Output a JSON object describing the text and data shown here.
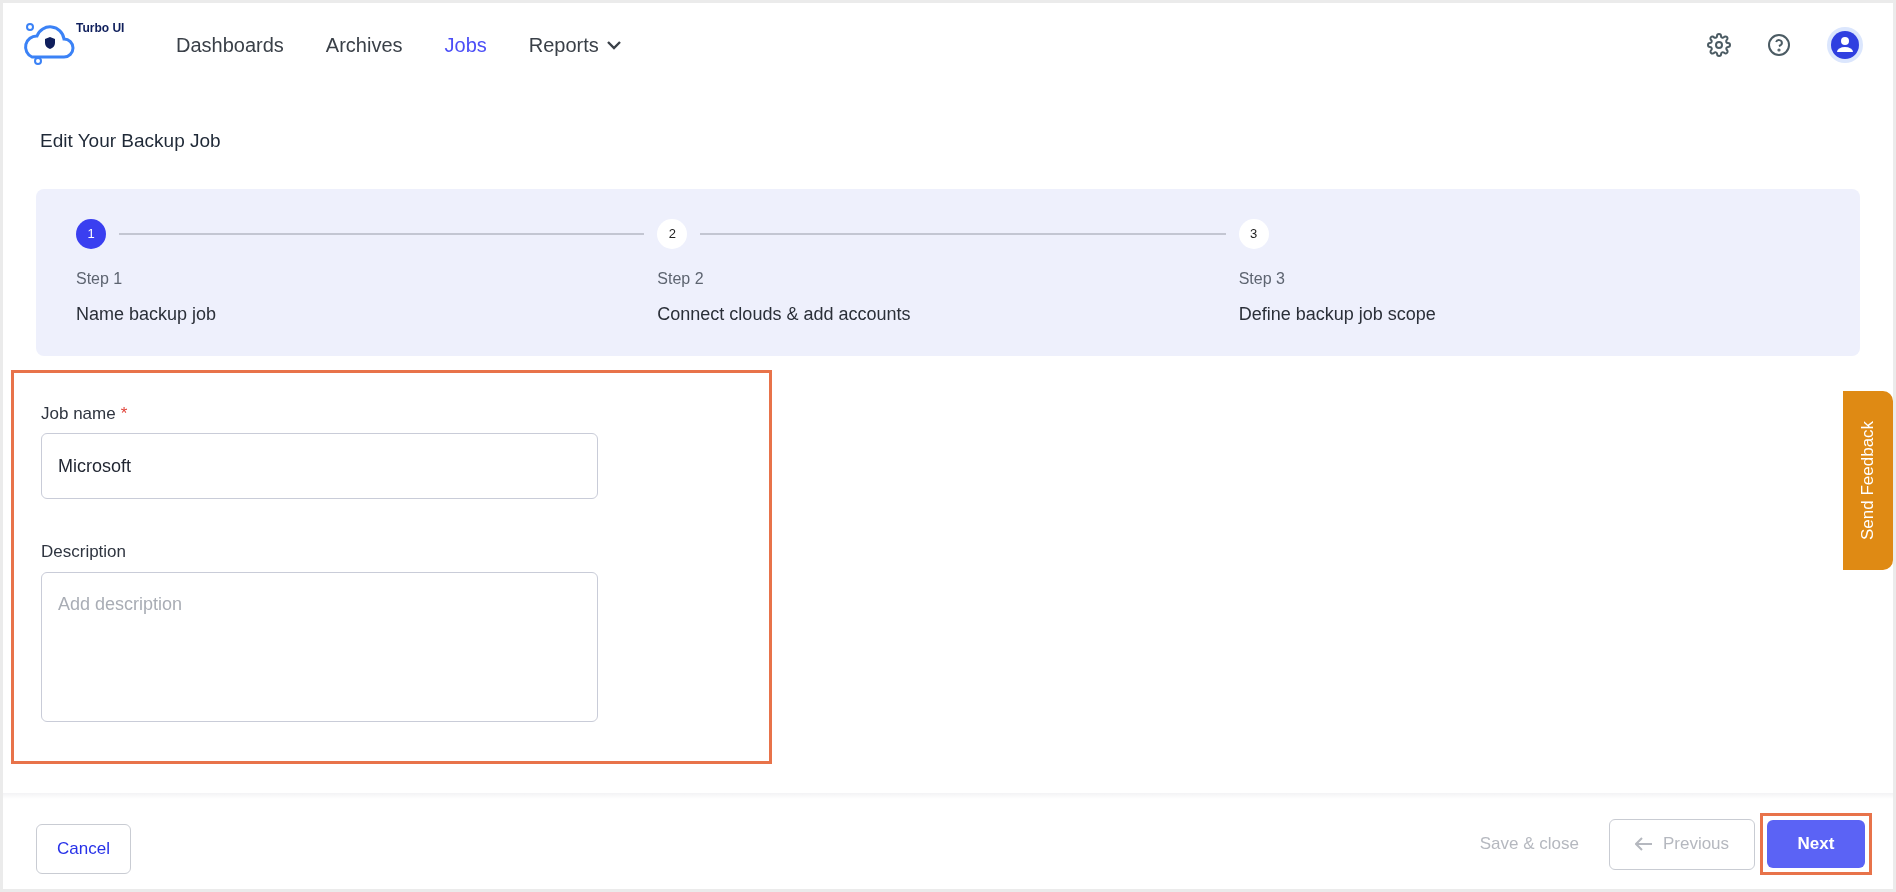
{
  "header": {
    "logo_text": "Turbo UI",
    "nav": [
      {
        "label": "Dashboards",
        "selected": false,
        "dropdown": false
      },
      {
        "label": "Archives",
        "selected": false,
        "dropdown": false
      },
      {
        "label": "Jobs",
        "selected": true,
        "dropdown": false
      },
      {
        "label": "Reports",
        "selected": false,
        "dropdown": true
      }
    ]
  },
  "page_title": "Edit Your Backup Job",
  "steps": [
    {
      "number": "1",
      "caption": "Step 1",
      "title": "Name backup job",
      "selected": true
    },
    {
      "number": "2",
      "caption": "Step 2",
      "title": "Connect clouds & add accounts",
      "selected": false
    },
    {
      "number": "3",
      "caption": "Step 3",
      "title": "Define backup job scope",
      "selected": false
    }
  ],
  "form": {
    "highlighted": true,
    "job_name": {
      "label": "Job name",
      "required_mark": "*",
      "value": "Microsoft"
    },
    "description": {
      "label": "Description",
      "placeholder": "Add description"
    }
  },
  "feedback_tab": "Send Feedback",
  "footer": {
    "cancel": "Cancel",
    "save_close": {
      "label": "Save & close",
      "disabled": true
    },
    "previous": {
      "label": "Previous",
      "disabled": true
    },
    "next": {
      "label": "Next",
      "highlighted": true
    }
  }
}
